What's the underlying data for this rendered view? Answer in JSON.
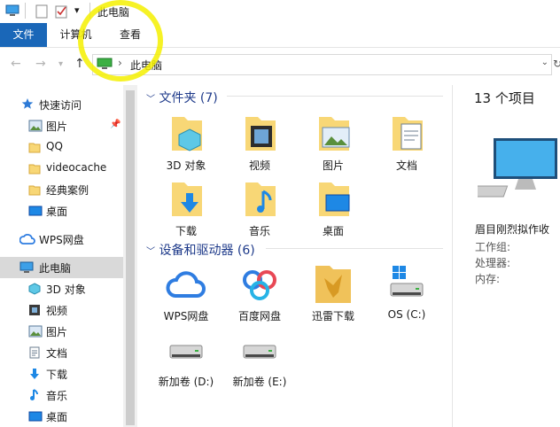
{
  "window": {
    "title": "此电脑"
  },
  "quick_access_toolbar": {
    "dropdown_glyph": "▾"
  },
  "ribbon": {
    "tabs": [
      {
        "label": "文件"
      },
      {
        "label": "计算机"
      },
      {
        "label": "查看"
      }
    ]
  },
  "address_bar": {
    "location": "此电脑",
    "separator": "›"
  },
  "nav_pane": {
    "quick_access": "快速访问",
    "items": [
      {
        "label": "图片",
        "icon": "pictures-icon"
      },
      {
        "label": "QQ",
        "icon": "folder-icon"
      },
      {
        "label": "videocache",
        "icon": "folder-icon"
      },
      {
        "label": "经典案例",
        "icon": "folder-icon"
      },
      {
        "label": "桌面",
        "icon": "desktop-icon"
      }
    ],
    "wps": "WPS网盘",
    "this_pc": "此电脑",
    "pc_items": [
      {
        "label": "3D 对象",
        "icon": "3d-objects-icon"
      },
      {
        "label": "视频",
        "icon": "videos-icon"
      },
      {
        "label": "图片",
        "icon": "pictures-icon"
      },
      {
        "label": "文档",
        "icon": "documents-icon"
      },
      {
        "label": "下载",
        "icon": "downloads-icon"
      },
      {
        "label": "音乐",
        "icon": "music-icon"
      },
      {
        "label": "桌面",
        "icon": "desktop-icon"
      }
    ]
  },
  "content": {
    "folders_header": "文件夹 (7)",
    "folders": [
      {
        "label": "3D 对象",
        "icon": "3d-objects-icon"
      },
      {
        "label": "视频",
        "icon": "videos-icon"
      },
      {
        "label": "图片",
        "icon": "pictures-icon"
      },
      {
        "label": "文档",
        "icon": "documents-icon"
      },
      {
        "label": "下载",
        "icon": "downloads-icon"
      },
      {
        "label": "音乐",
        "icon": "music-icon"
      },
      {
        "label": "桌面",
        "icon": "desktop-icon"
      }
    ],
    "devices_header": "设备和驱动器 (6)",
    "devices": [
      {
        "label": "WPS网盘",
        "icon": "wps-cloud-icon"
      },
      {
        "label": "百度网盘",
        "icon": "baidu-netdisk-icon"
      },
      {
        "label": "迅雷下载",
        "icon": "xunlei-download-icon"
      },
      {
        "label": "OS (C:)",
        "icon": "os-drive-icon"
      },
      {
        "label": "新加卷 (D:)",
        "icon": "drive-icon"
      },
      {
        "label": "新加卷 (E:)",
        "icon": "drive-icon"
      }
    ]
  },
  "details_pane": {
    "count": "13 个项目",
    "computer_name": "眉目刚烈拟作收",
    "workgroup_label": "工作组:",
    "processor_label": "处理器:",
    "memory_label": "内存:"
  },
  "colors": {
    "accent": "#1a67b8",
    "folder": "#f8d776",
    "highlight": "#f4f000",
    "group_header": "#1e3a8a"
  }
}
